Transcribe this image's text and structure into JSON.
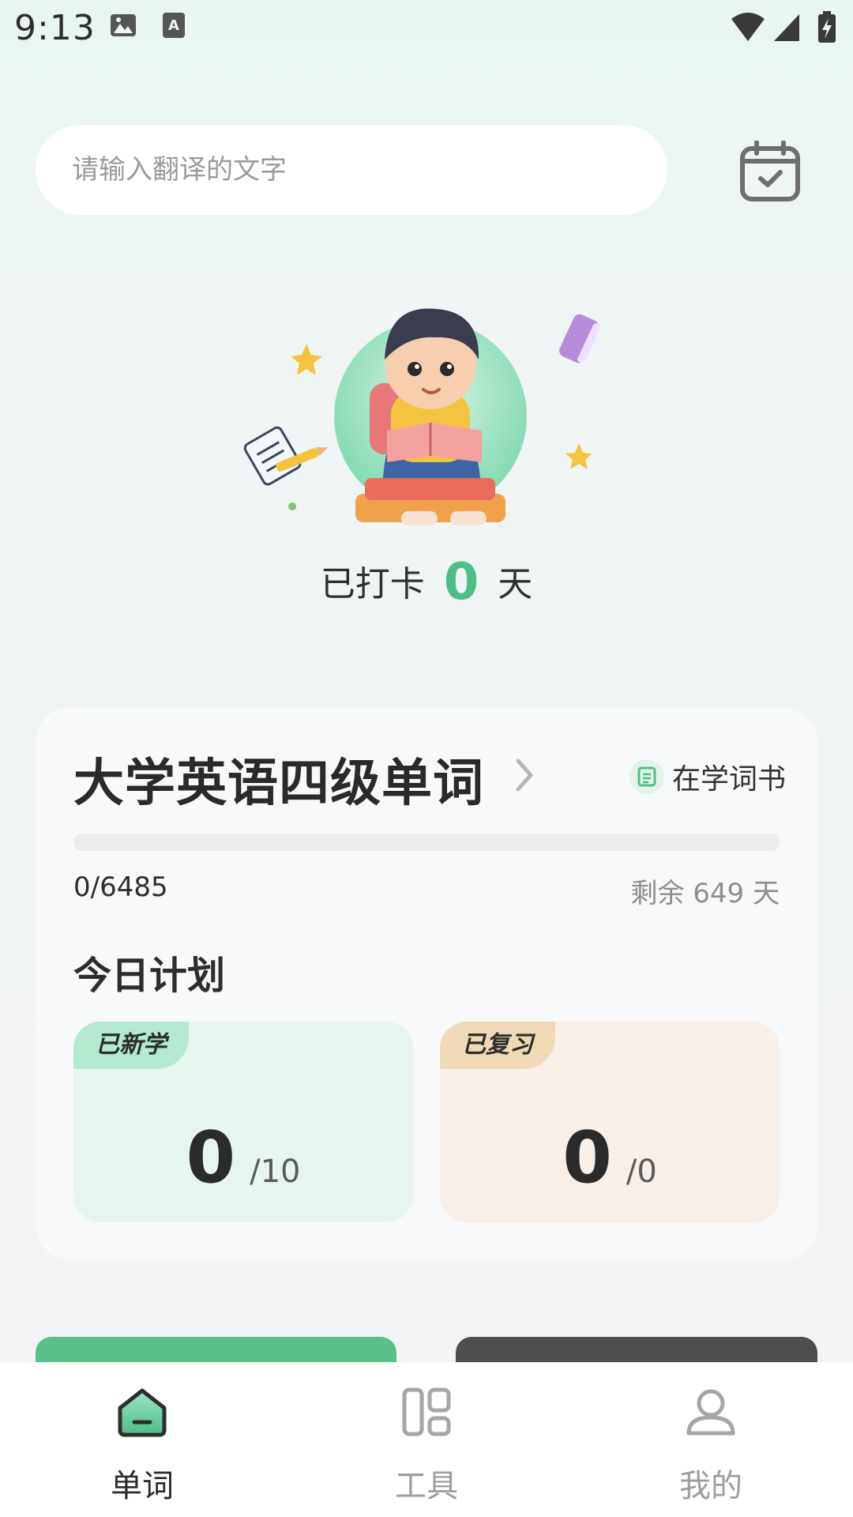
{
  "status_bar": {
    "time": "9:13"
  },
  "search": {
    "placeholder": "请输入翻译的文字"
  },
  "checkin": {
    "prefix": "已打卡",
    "days": "0",
    "suffix": "天"
  },
  "book": {
    "title": "大学英语四级单词",
    "status_label": "在学词书",
    "progress_count": "0/6485",
    "progress_fraction": 0,
    "remaining": "剩余 649 天"
  },
  "plan": {
    "title": "今日计划",
    "new": {
      "label": "已新学",
      "value": "0",
      "total": "/10"
    },
    "review": {
      "label": "已复习",
      "value": "0",
      "total": "/0"
    }
  },
  "tabs": [
    {
      "label": "单词",
      "icon": "home-icon",
      "active": true
    },
    {
      "label": "工具",
      "icon": "grid-icon",
      "active": false
    },
    {
      "label": "我的",
      "icon": "user-icon",
      "active": false
    }
  ],
  "colors": {
    "accent": "#4cbf88",
    "dark_button": "#4c4f4d"
  }
}
